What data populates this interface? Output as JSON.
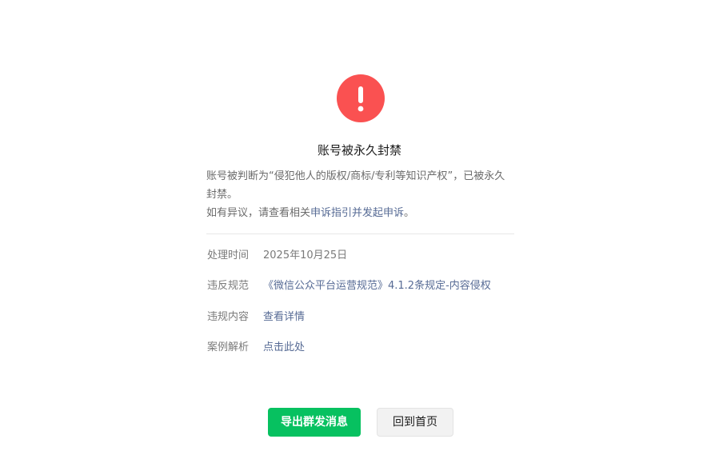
{
  "icon": {
    "name": "exclamation-icon",
    "color": "#fa5151"
  },
  "title": "账号被永久封禁",
  "description": {
    "line1": "账号被判断为“侵犯他人的版权/商标/专利等知识产权”，已被永久封禁。",
    "line2_prefix": "如有异议，请查看相关",
    "line2_link": "申诉指引并发起申诉",
    "line2_suffix": "。"
  },
  "details": [
    {
      "label": "处理时间",
      "value": "2025年10月25日",
      "is_link": false
    },
    {
      "label": "违反规范",
      "value": "《微信公众平台运营规范》4.1.2条规定-内容侵权",
      "is_link": true
    },
    {
      "label": "违规内容",
      "value": "查看详情",
      "is_link": true
    },
    {
      "label": "案例解析",
      "value": "点击此处",
      "is_link": true
    }
  ],
  "buttons": {
    "primary_label": "导出群发消息",
    "secondary_label": "回到首页"
  },
  "colors": {
    "primary": "#07c160",
    "link": "#576b95",
    "danger": "#fa5151"
  }
}
